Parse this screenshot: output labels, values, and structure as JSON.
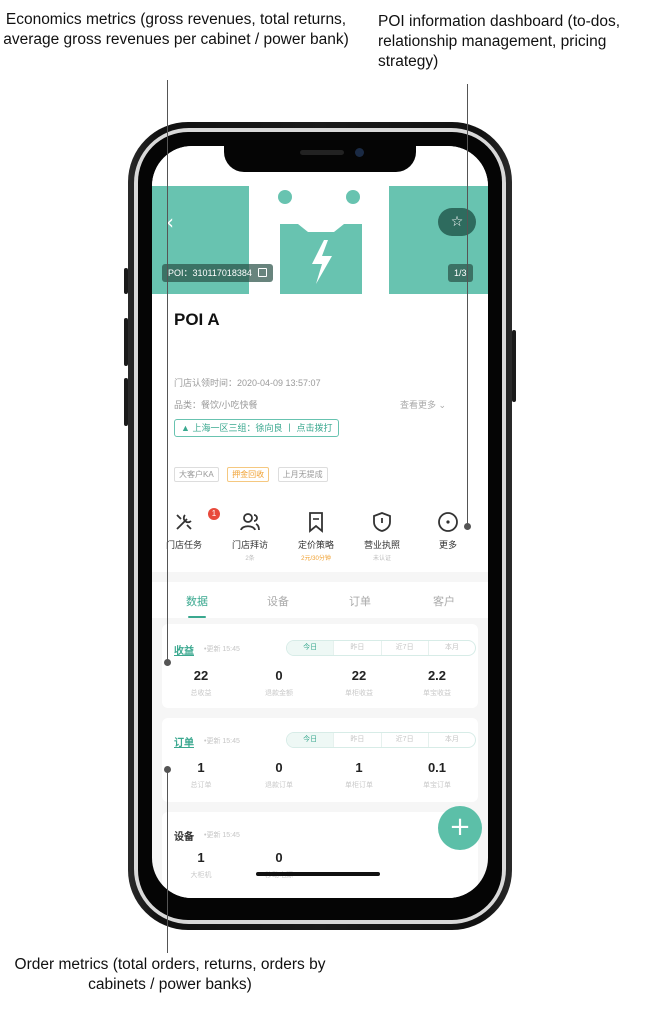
{
  "annotations": {
    "economics": "Economics metrics (gross revenues, total returns, average gross revenues per cabinet / power bank)",
    "poi_dashboard": "POI information dashboard (to-dos, relationship management, pricing strategy)",
    "orders": "Order metrics (total orders, returns, orders by cabinets / power banks)"
  },
  "colors": {
    "brand": "#68c3b0",
    "accent": "#3aa88f",
    "badge_red": "#e84a3c",
    "orange": "#f0a030"
  },
  "header": {
    "back_icon": "chevron-left-icon",
    "fav_icon": "star-icon",
    "poi_id": "POI：310117018384",
    "page_indicator": "1/3"
  },
  "info": {
    "poi_name": "POI A",
    "store_time": "门店认领时间：2020-04-09 13:57:07",
    "category": "品类：餐饮/小吃快餐",
    "see_more": "查看更多 ⌄",
    "manager": "上海一区三组：徐向良 丨 点击拨打",
    "tags": [
      "大客户KA",
      "押金回收",
      "上月无提成"
    ]
  },
  "actions": [
    {
      "icon": "tools-icon",
      "label": "门店任务",
      "sub": "",
      "badge": "1"
    },
    {
      "icon": "users-icon",
      "label": "门店拜访",
      "sub": "2条"
    },
    {
      "icon": "bookmark-icon",
      "label": "定价策略",
      "sub": "2元/30分钟"
    },
    {
      "icon": "shield-icon",
      "label": "营业执照",
      "sub": "未认证"
    },
    {
      "icon": "more-icon",
      "label": "更多",
      "sub": ""
    }
  ],
  "tabs": [
    "数据",
    "设备",
    "订单",
    "客户"
  ],
  "revenue_card": {
    "title": "收益",
    "updated": "•更新 15:45",
    "periods": [
      "今日",
      "昨日",
      "近7日",
      "本月"
    ],
    "metrics": [
      {
        "value": "22",
        "label": "总收益"
      },
      {
        "value": "0",
        "label": "退款金额"
      },
      {
        "value": "22",
        "label": "单柜收益"
      },
      {
        "value": "2.2",
        "label": "单宝收益"
      }
    ]
  },
  "order_card": {
    "title": "订单",
    "updated": "•更新 15:45",
    "periods": [
      "今日",
      "昨日",
      "近7日",
      "本月"
    ],
    "metrics": [
      {
        "value": "1",
        "label": "总订单"
      },
      {
        "value": "0",
        "label": "退款订单"
      },
      {
        "value": "1",
        "label": "单柜订单"
      },
      {
        "value": "0.1",
        "label": "单宝订单"
      }
    ]
  },
  "device_card": {
    "title": "设备",
    "updated": "•更新 15:45",
    "metrics": [
      {
        "value": "1",
        "label": "大柜机"
      },
      {
        "value": "0",
        "label": "移动电源"
      }
    ]
  },
  "fab_label": "+"
}
